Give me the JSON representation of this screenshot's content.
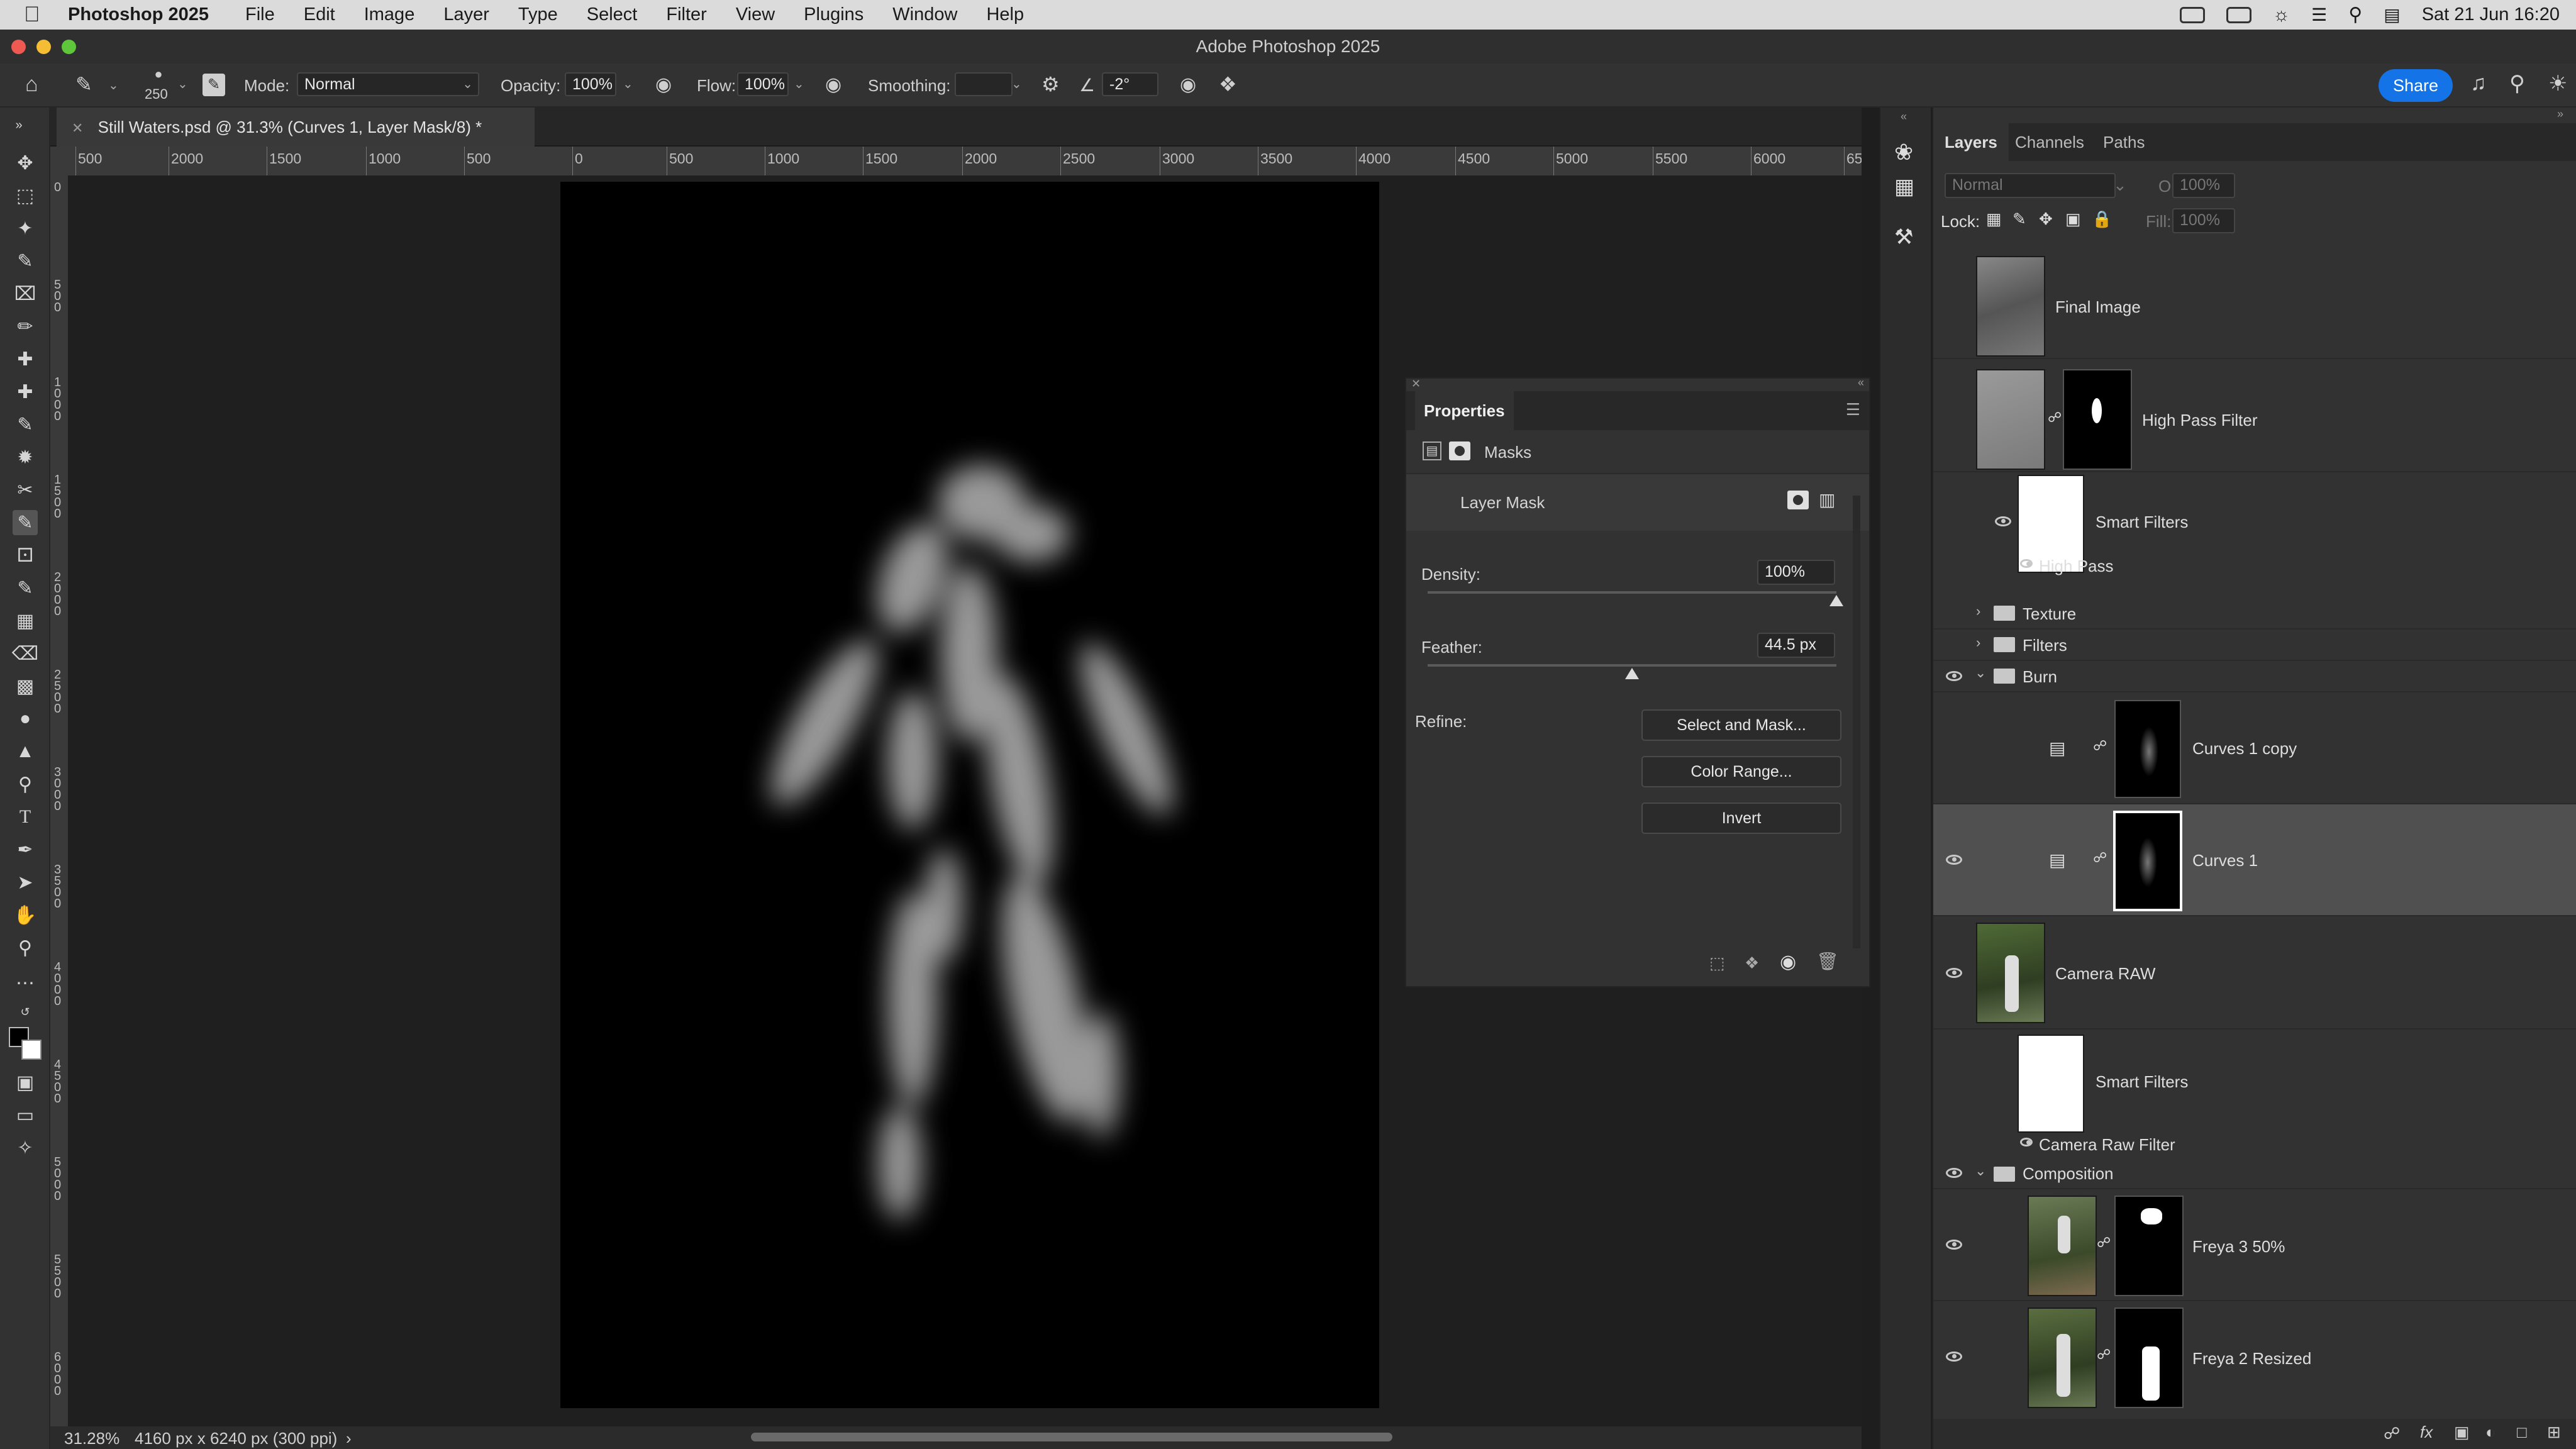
{
  "menubar": {
    "app_name": "Photoshop 2025",
    "items": [
      "File",
      "Edit",
      "Image",
      "Layer",
      "Type",
      "Select",
      "Filter",
      "View",
      "Plugins",
      "Window",
      "Help"
    ],
    "clock": "Sat 21 Jun  16:20"
  },
  "window": {
    "title": "Adobe Photoshop 2025"
  },
  "options_bar": {
    "brush_size": "250",
    "mode_label": "Mode:",
    "mode_value": "Normal",
    "opacity_label": "Opacity:",
    "opacity_value": "100%",
    "flow_label": "Flow:",
    "flow_value": "100%",
    "smoothing_label": "Smoothing:",
    "smoothing_value": "",
    "angle_value": "-2°",
    "share_label": "Share"
  },
  "document": {
    "tab_title": "Still Waters.psd @ 31.3% (Curves 1, Layer Mask/8) *",
    "zoom": "31.28%",
    "info": "4160 px x 6240 px (300 ppi)",
    "ruler_labels": [
      "500",
      "2000",
      "1500",
      "1000",
      "500",
      "0",
      "500",
      "1000",
      "1500",
      "2000",
      "2500",
      "3000",
      "3500",
      "4000",
      "4500",
      "5000",
      "5500",
      "6000",
      "65"
    ],
    "vruler_labels": [
      "0",
      "500",
      "1000",
      "1500",
      "2000",
      "2500",
      "3000",
      "3500",
      "4000",
      "4500",
      "5000",
      "5500",
      "6000"
    ]
  },
  "properties": {
    "title": "Properties",
    "section": "Masks",
    "mask_type": "Layer Mask",
    "density_label": "Density:",
    "density_value": "100%",
    "density_level": 1.0,
    "feather_label": "Feather:",
    "feather_value": "44.5 px",
    "feather_level": 0.5,
    "refine_label": "Refine:",
    "buttons": [
      "Select and Mask...",
      "Color Range...",
      "Invert"
    ]
  },
  "layers_panel": {
    "tabs": [
      "Layers",
      "Channels",
      "Paths"
    ],
    "blend_mode": "Normal",
    "opacity_label": "Opacity:",
    "opacity_value": "100%",
    "lock_label": "Lock:",
    "fill_label": "Fill:",
    "fill_value": "100%",
    "layers": [
      {
        "name": "Final Image",
        "visible": false
      },
      {
        "name": "High Pass Filter",
        "visible": false
      },
      {
        "name": "Smart Filters",
        "visible": false
      },
      {
        "name": "High Pass",
        "visible": true
      },
      {
        "name": "Texture",
        "visible": false
      },
      {
        "name": "Filters",
        "visible": false
      },
      {
        "name": "Burn",
        "visible": true
      },
      {
        "name": "Curves 1 copy",
        "visible": false
      },
      {
        "name": "Curves 1",
        "visible": true,
        "selected": true
      },
      {
        "name": "Camera RAW",
        "visible": true
      },
      {
        "name": "Smart Filters",
        "visible": true
      },
      {
        "name": "Camera Raw Filter",
        "visible": true
      },
      {
        "name": "Composition",
        "visible": true
      },
      {
        "name": "Freya 3 50%",
        "visible": true
      },
      {
        "name": "Freya 2 Resized",
        "visible": true
      }
    ]
  }
}
